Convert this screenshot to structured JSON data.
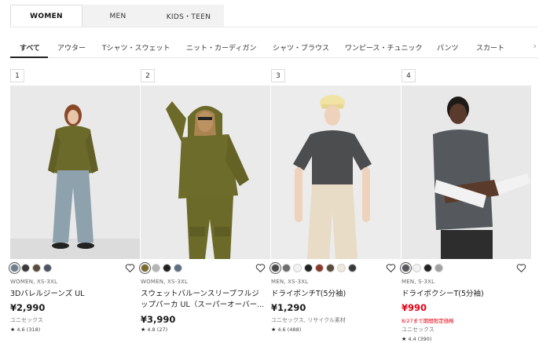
{
  "gender_tabs": [
    {
      "label": "WOMEN",
      "active": true
    },
    {
      "label": "MEN",
      "active": false
    },
    {
      "label": "KIDS・TEEN",
      "active": false
    }
  ],
  "category_tabs": [
    {
      "label": "すべて",
      "active": true
    },
    {
      "label": "アウター"
    },
    {
      "label": "Tシャツ・スウェット"
    },
    {
      "label": "ニット・カーディガン"
    },
    {
      "label": "シャツ・ブラウス"
    },
    {
      "label": "ワンピース・チュニック"
    },
    {
      "label": "パンツ"
    },
    {
      "label": "スカート"
    }
  ],
  "category_more_icon": "chevron-right-icon",
  "products": [
    {
      "rank": "1",
      "swatches": [
        "#6b7f8c",
        "#3a3a3a",
        "#5a4a3a",
        "#4b5563"
      ],
      "meta": "WOMEN, XS-3XL",
      "name": "3Dバレルジーンズ UL",
      "price": "¥2,990",
      "sub": "ユニセックス",
      "rating": "4.6",
      "reviews": "(318)"
    },
    {
      "rank": "2",
      "swatches": [
        "#7a6a2a",
        "#b5b5b5",
        "#222222",
        "#5d7083"
      ],
      "meta": "WOMEN, XS-3XL",
      "name": "スウェットバルーンスリーブフルジップパーカ UL（スーパーオーバー...",
      "price": "¥3,990",
      "sub": "",
      "rating": "4.8",
      "reviews": "(27)"
    },
    {
      "rank": "3",
      "swatches": [
        "#4a4a4a",
        "#6e6e6e",
        "#f2f2f2",
        "#222222",
        "#8a3a2a",
        "#5a4a3a",
        "#efe8da",
        "#3a3a3a"
      ],
      "meta": "MEN, XS-3XL",
      "name": "ドライポンチT(5分袖)",
      "price": "¥1,290",
      "sub": "ユニセックス, リサイクル素材",
      "rating": "4.6",
      "reviews": "(488)"
    },
    {
      "rank": "4",
      "swatches": [
        "#55595e",
        "#f2f2f2",
        "#222222",
        "#a0a0a0"
      ],
      "meta": "MEN, S-3XL",
      "name": "ドライボクシーT(5分袖)",
      "price": "¥990",
      "promo": "8/27まで期間限定価格",
      "sub": "ユニセックス",
      "rating": "4.4",
      "reviews": "(390)"
    }
  ],
  "colors": {
    "sale": "#e60012",
    "text": "#1b1b1b",
    "tab_bg": "#f2f2f2"
  }
}
